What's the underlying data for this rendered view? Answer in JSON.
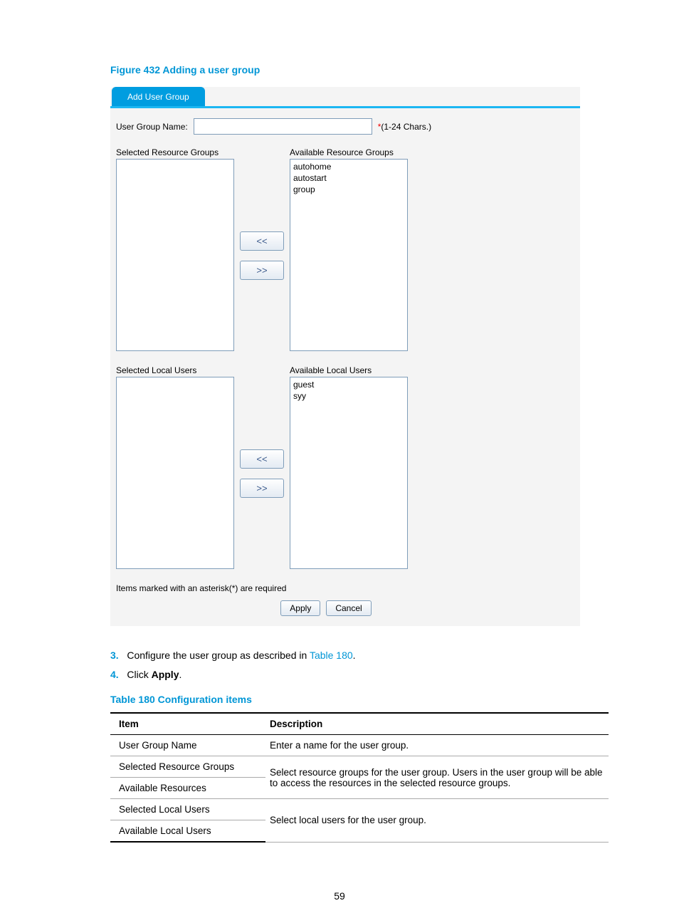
{
  "figure_title": "Figure 432 Adding a user group",
  "tab_label": "Add User Group",
  "fields": {
    "group_name_label": "User Group Name:",
    "group_name_value": "",
    "group_name_star": "*",
    "group_name_hint": "(1-24 Chars.)"
  },
  "resource_groups": {
    "selected_label": "Selected Resource Groups",
    "available_label": "Available Resource Groups",
    "selected_items": [],
    "available_items": [
      "autohome",
      "autostart",
      "group"
    ],
    "move_left": "<<",
    "move_right": ">>"
  },
  "local_users": {
    "selected_label": "Selected Local Users",
    "available_label": "Available Local Users",
    "selected_items": [],
    "available_items": [
      "guest",
      "syy"
    ],
    "move_left": "<<",
    "move_right": ">>"
  },
  "asterisk_note": "Items marked with an asterisk(*) are required",
  "actions": {
    "apply": "Apply",
    "cancel": "Cancel"
  },
  "steps": {
    "s3_num": "3.",
    "s3_a": "Configure the user group as described in ",
    "s3_link": "Table 180",
    "s3_b": ".",
    "s4_num": "4.",
    "s4_a": "Click ",
    "s4_bold": "Apply",
    "s4_b": "."
  },
  "table_title": "Table 180 Configuration items",
  "table_headers": {
    "item": "Item",
    "desc": "Description"
  },
  "table_rows": {
    "r1_item": "User Group Name",
    "r1_desc": "Enter a name for the user group.",
    "r2_item": "Selected Resource Groups",
    "r3_item": "Available Resources",
    "r23_desc": "Select resource groups for the user group. Users in the user group will be able to access the resources in the selected resource groups.",
    "r4_item": "Selected Local Users",
    "r5_item": "Available Local Users",
    "r45_desc": "Select local users for the user group."
  },
  "page_number": "59"
}
